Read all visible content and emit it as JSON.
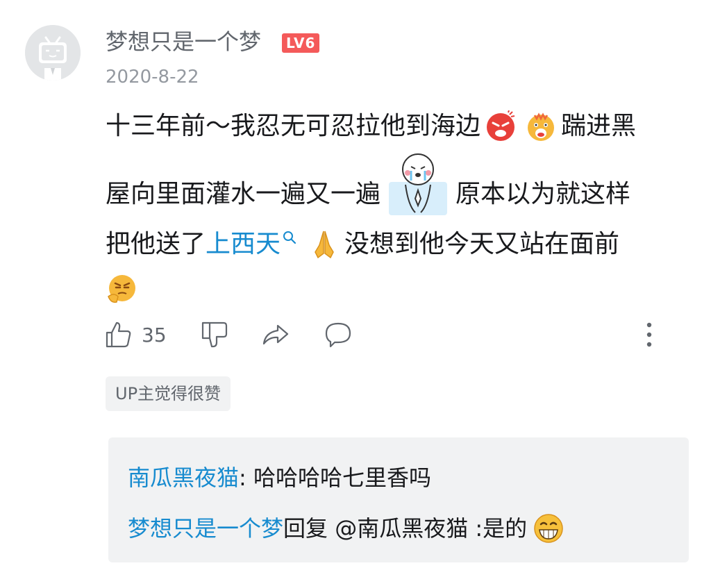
{
  "comment": {
    "username": "梦想只是一个梦",
    "level": "LV6",
    "date": "2020-8-22",
    "lines": [
      {
        "pre": "十三年前～我忍无可忍拉他到海边",
        "post": "踹进黑"
      },
      {
        "pre": "屋向里面灌水一遍又一遍",
        "post": "原本以为就这样"
      },
      {
        "pre": "把他送了",
        "link": "上西天",
        "post": "没想到他今天又站在面前"
      }
    ],
    "icons": {
      "avatar": "bilibili-tv-avatar-icon",
      "angry": "angry-face-emoji",
      "shocked": "shocked-face-emoji",
      "sticker": "crying-pray-sticker",
      "search": "search-icon",
      "pray": "folded-hands-emoji",
      "pondering": "pondering-face-emoji"
    }
  },
  "actions": {
    "like_count": "35",
    "icons": [
      "thumbs-up-icon",
      "thumbs-down-icon",
      "share-icon",
      "reply-icon",
      "more-icon"
    ]
  },
  "up_badge": "UP主觉得很赞",
  "replies": [
    {
      "name": "南瓜黑夜猫",
      "text": ": 哈哈哈哈七里香吗"
    },
    {
      "name": "梦想只是一个梦",
      "text": " 回复 @南瓜黑夜猫 :是的"
    }
  ],
  "colors": {
    "link": "#178bcf",
    "level_badge": "#f45a5a",
    "reply_bg": "#f1f2f3"
  }
}
